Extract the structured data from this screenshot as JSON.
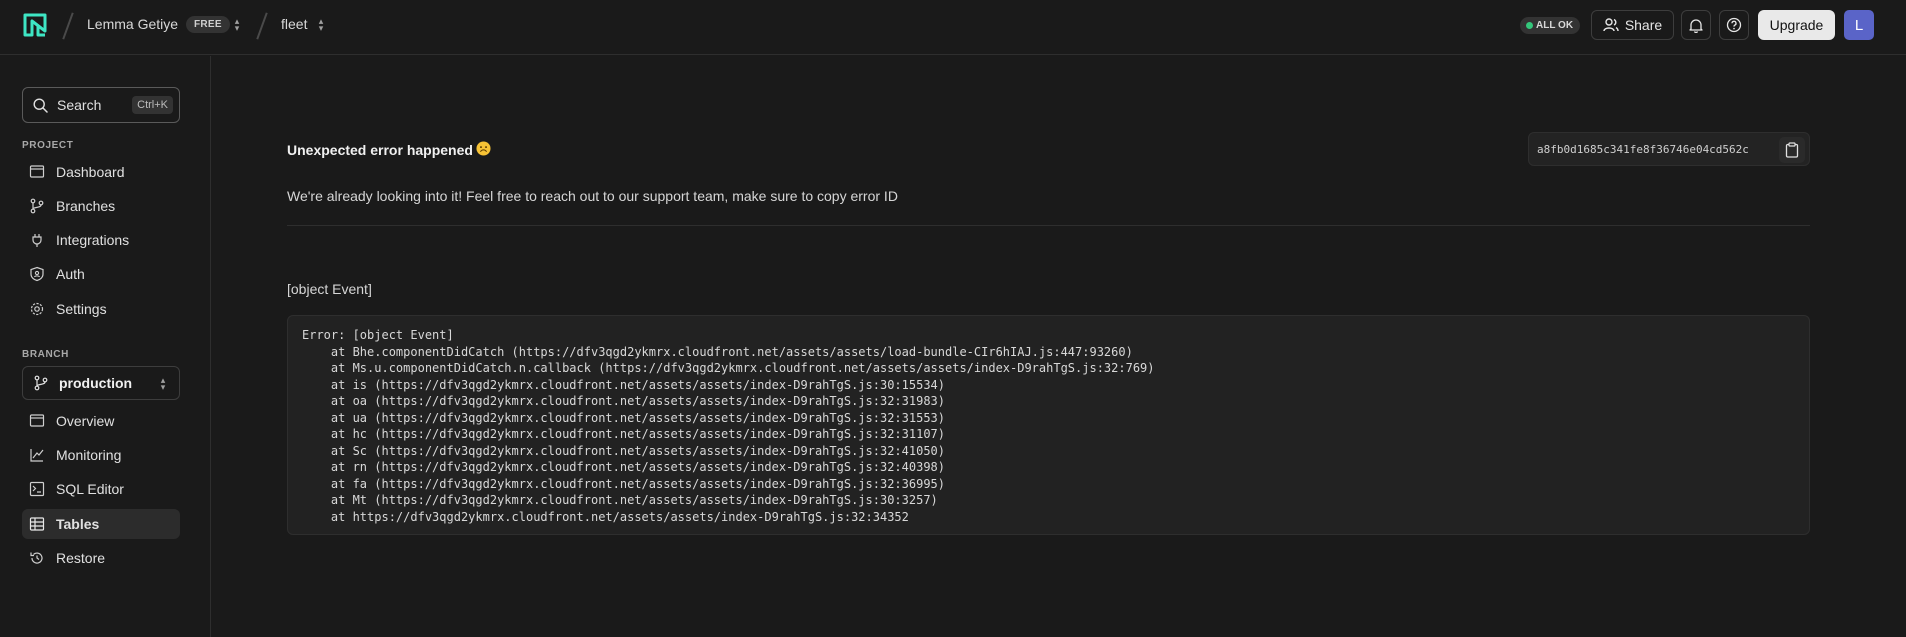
{
  "topbar": {
    "org_name": "Lemma Getiye",
    "plan_badge": "FREE",
    "project_name": "fleet",
    "status": "ALL OK",
    "share_label": "Share",
    "upgrade_label": "Upgrade",
    "avatar_initial": "L"
  },
  "sidebar": {
    "search_label": "Search",
    "search_shortcut": "Ctrl+K",
    "project_section": "PROJECT",
    "project_items": [
      {
        "label": "Dashboard",
        "icon": "dashboard-icon"
      },
      {
        "label": "Branches",
        "icon": "branches-icon"
      },
      {
        "label": "Integrations",
        "icon": "integrations-icon"
      },
      {
        "label": "Auth",
        "icon": "auth-shield-icon"
      },
      {
        "label": "Settings",
        "icon": "settings-gear-icon"
      }
    ],
    "branch_section": "BRANCH",
    "branch_name": "production",
    "branch_items": [
      {
        "label": "Overview",
        "icon": "overview-icon"
      },
      {
        "label": "Monitoring",
        "icon": "monitoring-icon"
      },
      {
        "label": "SQL Editor",
        "icon": "sql-editor-icon"
      },
      {
        "label": "Tables",
        "icon": "tables-icon",
        "active": true
      },
      {
        "label": "Restore",
        "icon": "restore-icon"
      }
    ]
  },
  "main": {
    "error_title": "Unexpected error happened",
    "error_id": "a8fb0d1685c341fe8f36746e04cd562c",
    "error_description": "We're already looking into it! Feel free to reach out to our support team, make sure to copy error ID",
    "error_message": "[object Event]",
    "stack_trace": [
      "Error: [object Event]",
      "    at Bhe.componentDidCatch (https://dfv3qgd2ykmrx.cloudfront.net/assets/assets/load-bundle-CIr6hIAJ.js:447:93260)",
      "    at Ms.u.componentDidCatch.n.callback (https://dfv3qgd2ykmrx.cloudfront.net/assets/assets/index-D9rahTgS.js:32:769)",
      "    at is (https://dfv3qgd2ykmrx.cloudfront.net/assets/assets/index-D9rahTgS.js:30:15534)",
      "    at oa (https://dfv3qgd2ykmrx.cloudfront.net/assets/assets/index-D9rahTgS.js:32:31983)",
      "    at ua (https://dfv3qgd2ykmrx.cloudfront.net/assets/assets/index-D9rahTgS.js:32:31553)",
      "    at hc (https://dfv3qgd2ykmrx.cloudfront.net/assets/assets/index-D9rahTgS.js:32:31107)",
      "    at Sc (https://dfv3qgd2ykmrx.cloudfront.net/assets/assets/index-D9rahTgS.js:32:41050)",
      "    at rn (https://dfv3qgd2ykmrx.cloudfront.net/assets/assets/index-D9rahTgS.js:32:40398)",
      "    at fa (https://dfv3qgd2ykmrx.cloudfront.net/assets/assets/index-D9rahTgS.js:32:36995)",
      "    at Mt (https://dfv3qgd2ykmrx.cloudfront.net/assets/assets/index-D9rahTgS.js:30:3257)",
      "    at https://dfv3qgd2ykmrx.cloudfront.net/assets/assets/index-D9rahTgS.js:32:34352"
    ]
  },
  "colors": {
    "background": "#1a1a1a",
    "accent_green": "#34c77b",
    "avatar": "#5a64c8",
    "logo_green": "#3ee6c4"
  }
}
